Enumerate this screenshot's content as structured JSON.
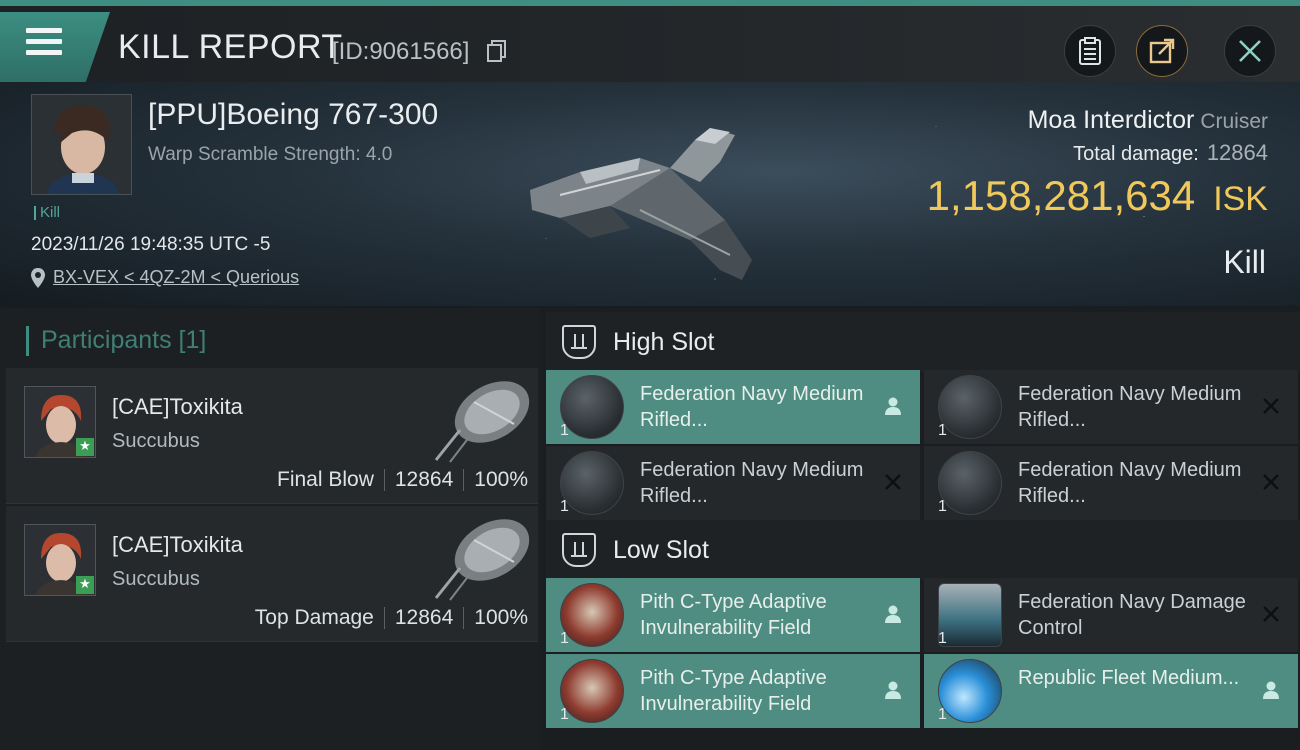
{
  "header": {
    "title": "KILL REPORT",
    "kill_id": "[ID:9061566]"
  },
  "victim": {
    "name": "[PPU]Boeing 767-300",
    "warp_scramble": "Warp Scramble Strength: 4.0",
    "kill_tag": "Kill",
    "datetime": "2023/11/26 19:48:35 UTC -5",
    "location": "BX-VEX < 4QZ-2M < Querious",
    "ship_name": "Moa Interdictor",
    "ship_class": "Cruiser",
    "total_damage_label": "Total damage:",
    "total_damage": "12864",
    "isk_value": "1,158,281,634",
    "isk_unit": "ISK",
    "kill_type": "Kill"
  },
  "participants": {
    "header": "Participants [1]",
    "items": [
      {
        "name": "[CAE]Toxikita",
        "ship": "Succubus",
        "role": "Final Blow",
        "damage": "12864",
        "percent": "100%"
      },
      {
        "name": "[CAE]Toxikita",
        "ship": "Succubus",
        "role": "Top Damage",
        "damage": "12864",
        "percent": "100%"
      }
    ]
  },
  "fitting": {
    "high_slot_label": "High Slot",
    "low_slot_label": "Low Slot",
    "high_modules": [
      {
        "name": "Federation Navy Medium Rifled...",
        "qty": "1",
        "state": "fitted"
      },
      {
        "name": "Federation Navy Medium Rifled...",
        "qty": "1",
        "state": "destroyed"
      },
      {
        "name": "Federation Navy Medium Rifled...",
        "qty": "1",
        "state": "destroyed"
      },
      {
        "name": "Federation Navy Medium Rifled...",
        "qty": "1",
        "state": "destroyed"
      }
    ],
    "low_modules": [
      {
        "name": "Pith C-Type Adaptive Invulnerability Field",
        "qty": "1",
        "state": "fitted"
      },
      {
        "name": "Federation Navy Damage Control",
        "qty": "1",
        "state": "destroyed"
      },
      {
        "name": "Pith C-Type Adaptive Invulnerability Field",
        "qty": "1",
        "state": "fitted"
      },
      {
        "name": "Republic Fleet Medium...",
        "qty": "1",
        "state": "fitted"
      }
    ]
  },
  "colors": {
    "accent": "#3d8e82",
    "isk": "#f1c85a",
    "module_active": "#4f8d82"
  }
}
